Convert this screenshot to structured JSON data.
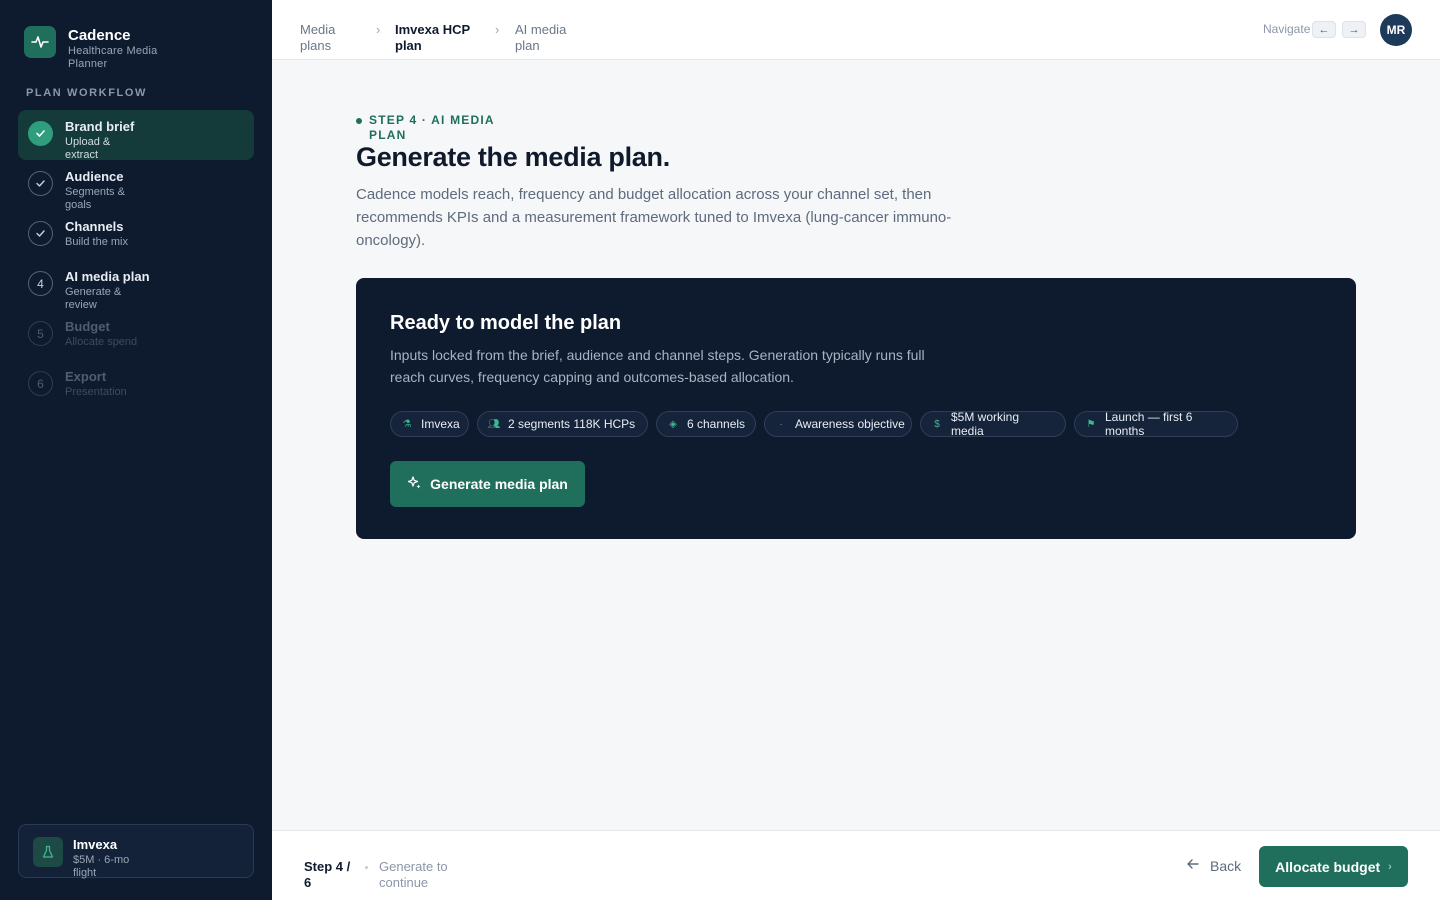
{
  "app": {
    "name": "Cadence",
    "subtitle": "Healthcare Media Planner"
  },
  "sidebar": {
    "section_label": "PLAN WORKFLOW",
    "steps": [
      {
        "marker": "",
        "title": "Brand brief",
        "sub": "Upload & extract",
        "state": "active"
      },
      {
        "marker": "",
        "title": "Audience",
        "sub": "Segments & goals",
        "state": "done"
      },
      {
        "marker": "",
        "title": "Channels",
        "sub": "Build the mix",
        "state": "done"
      },
      {
        "marker": "4",
        "title": "AI media plan",
        "sub": "Generate & review",
        "state": "current"
      },
      {
        "marker": "5",
        "title": "Budget",
        "sub": "Allocate spend",
        "state": "future"
      },
      {
        "marker": "6",
        "title": "Export",
        "sub": "Presentation",
        "state": "future"
      }
    ],
    "product": {
      "name": "Imvexa",
      "meta": "$5M · 6-mo flight"
    }
  },
  "topbar": {
    "breadcrumbs": [
      "Media plans",
      "Imvexa HCP plan",
      "AI media plan"
    ],
    "nav_hint": "Navigate",
    "prev_key": "←",
    "next_key": "→",
    "avatar_initials": "MR"
  },
  "main": {
    "eyebrow": "STEP 4 · AI MEDIA PLAN",
    "title": "Generate the media plan.",
    "description": "Cadence models reach, frequency and budget allocation across your channel set, then recommends KPIs and a measurement framework tuned to Imvexa (lung-cancer immuno-oncology).",
    "panel": {
      "title": "Ready to model the plan",
      "description": "Inputs locked from the brief, audience and channel steps. Generation typically runs full reach curves, frequency capping and outcomes-based allocation.",
      "chips": [
        {
          "icon": "flask-icon",
          "label": "Imvexa"
        },
        {
          "icon": "users-icon",
          "label": "2  segments 118K  HCPs"
        },
        {
          "icon": "layers-icon",
          "label": "6  channels"
        },
        {
          "icon": "target-icon",
          "label": "Awareness  objective"
        },
        {
          "icon": "dollar-icon",
          "label": "$5M  working media"
        },
        {
          "icon": "flag-icon",
          "label": "Launch — first 6 months"
        }
      ],
      "generate_label": "Generate media plan"
    }
  },
  "footer": {
    "step_count": "Step 4 / 6",
    "hint": "Generate to continue",
    "back_label": "Back",
    "next_label": "Allocate budget"
  },
  "colors": {
    "sidebar_bg": "#0e1a2e",
    "accent": "#1f6f5c",
    "active_step_bg": "#143a3a",
    "check_green": "#2f9e7c"
  }
}
